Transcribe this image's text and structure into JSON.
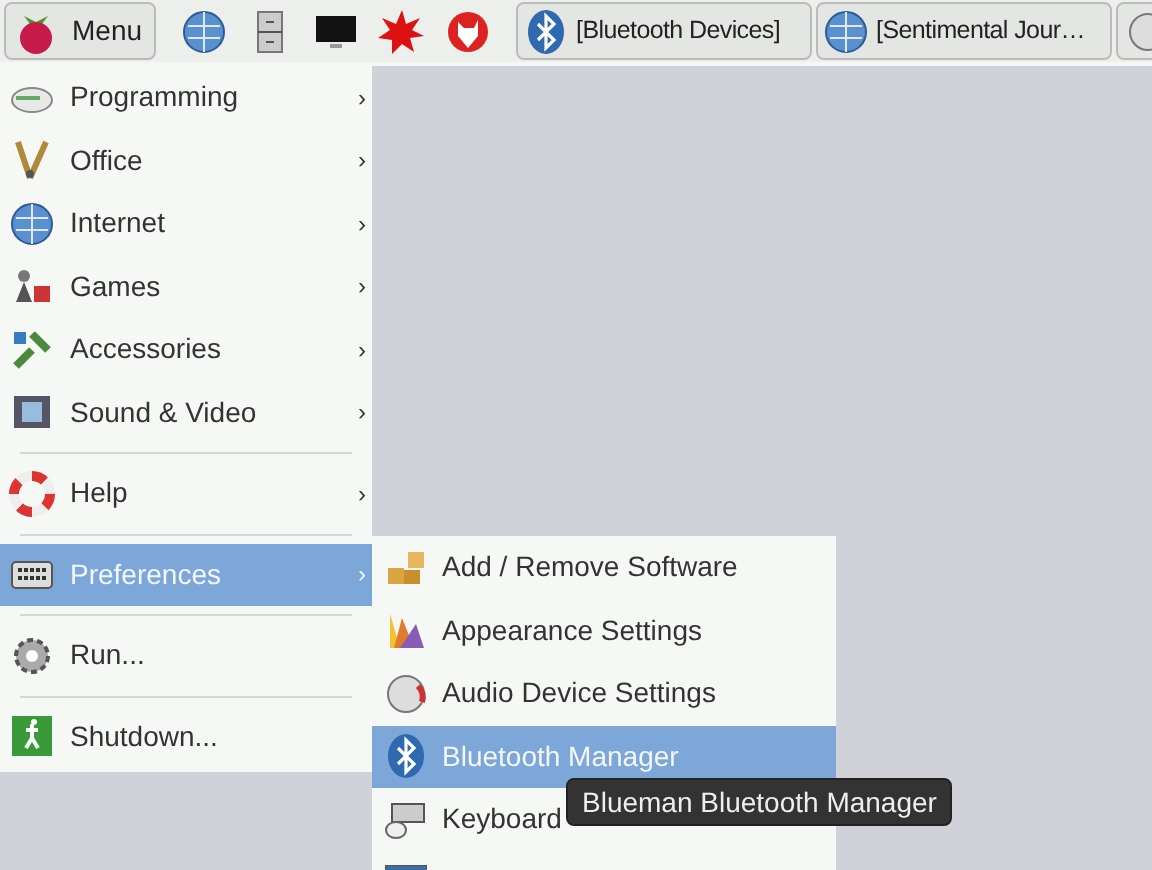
{
  "taskbar": {
    "menu_button": {
      "label": "Menu"
    },
    "windows": [
      {
        "label": "[Bluetooth Devices]"
      },
      {
        "label": "[Sentimental Jour…"
      }
    ]
  },
  "main_menu": {
    "items": [
      {
        "kind": "item",
        "label": "Programming",
        "arrow": "›",
        "selected": false
      },
      {
        "kind": "item",
        "label": "Office",
        "arrow": "›",
        "selected": false
      },
      {
        "kind": "item",
        "label": "Internet",
        "arrow": "›",
        "selected": false
      },
      {
        "kind": "item",
        "label": "Games",
        "arrow": "›",
        "selected": false
      },
      {
        "kind": "item",
        "label": "Accessories",
        "arrow": "›",
        "selected": false
      },
      {
        "kind": "item",
        "label": "Sound & Video",
        "arrow": "›",
        "selected": false
      },
      {
        "kind": "separator"
      },
      {
        "kind": "item",
        "label": "Help",
        "arrow": "›",
        "selected": false
      },
      {
        "kind": "separator"
      },
      {
        "kind": "item",
        "label": "Preferences",
        "arrow": "›",
        "selected": true
      },
      {
        "kind": "separator"
      },
      {
        "kind": "item",
        "label": "Run...",
        "selected": false
      },
      {
        "kind": "separator"
      },
      {
        "kind": "item",
        "label": "Shutdown...",
        "selected": false
      }
    ]
  },
  "submenu": {
    "items": [
      {
        "label": "Add / Remove Software",
        "selected": false
      },
      {
        "label": "Appearance Settings",
        "selected": false
      },
      {
        "label": "Audio Device Settings",
        "selected": false
      },
      {
        "label": "Bluetooth Manager",
        "selected": true
      },
      {
        "label": "Keyboard",
        "selected": false
      },
      {
        "selected": false
      }
    ]
  },
  "tooltip": {
    "text": "Blueman Bluetooth Manager"
  }
}
